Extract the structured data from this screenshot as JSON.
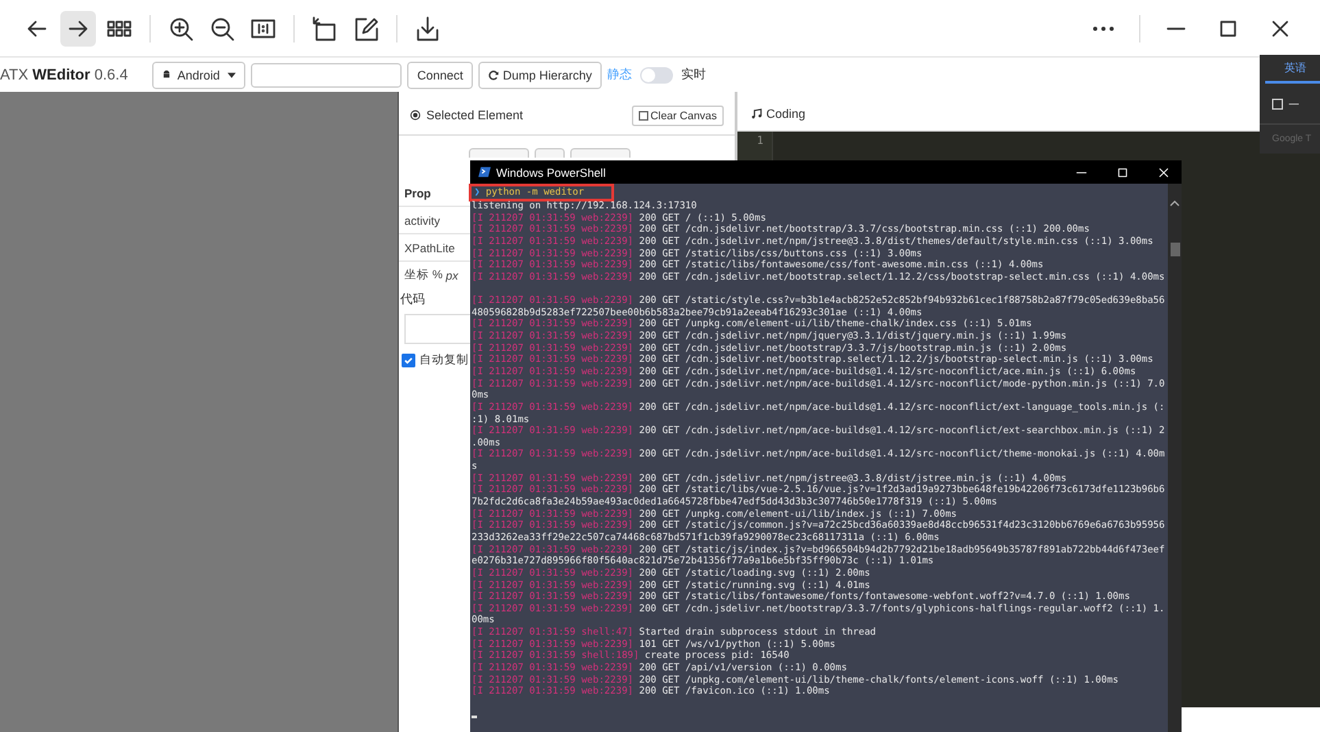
{
  "browser_toolbar": {
    "groups": [
      [
        {
          "kind": "back",
          "selected": false
        },
        {
          "kind": "forward",
          "selected": true
        },
        {
          "kind": "apps",
          "selected": false
        }
      ],
      [
        {
          "kind": "zoom-in",
          "selected": false
        },
        {
          "kind": "zoom-out",
          "selected": false
        },
        {
          "kind": "actual-size",
          "selected": false
        }
      ],
      [
        {
          "kind": "rotate",
          "selected": false
        },
        {
          "kind": "edit",
          "selected": false
        }
      ],
      [
        {
          "kind": "download",
          "selected": false
        }
      ]
    ],
    "window_buttons": [
      {
        "kind": "more"
      },
      {
        "kind": "minimize"
      },
      {
        "kind": "maximize"
      },
      {
        "kind": "close"
      }
    ]
  },
  "header": {
    "title": "ATX **WEditor** 0.6.4",
    "platform": "Android",
    "connect": "Connect",
    "dump": "Dump Hierarchy",
    "static_label": "静态",
    "live_label": "实时",
    "live": false
  },
  "inspector": {
    "title": "Selected Element",
    "clear": "Clear Canvas",
    "props": [
      "Prop",
      "activity",
      "XPathLite"
    ],
    "coord": "坐标 % *px*",
    "code": "代码",
    "auto_copy": {
      "label": "自动复制",
      "checked": true
    }
  },
  "coding": {
    "title": "Coding",
    "line_numbers": [
      "1"
    ]
  },
  "translate": {
    "tab": "英语",
    "option": {
      "label": "一",
      "checked": false
    },
    "footer": "Google T"
  },
  "powershell": {
    "title": "Windows PowerShell",
    "prompt": "❯",
    "command": "python -m weditor",
    "highlighted": true,
    "lines": [
      {
        "kind": "plain",
        "text": "listening on http://192.168.124.3:17310"
      },
      {
        "kind": "log",
        "prefix": "[I 211207 01:31:59 web:2239]",
        "text": "200 GET / (::1) 5.00ms"
      },
      {
        "kind": "log",
        "prefix": "[I 211207 01:31:59 web:2239]",
        "text": "200 GET /cdn.jsdelivr.net/bootstrap/3.3.7/css/bootstrap.min.css (::1) 200.00ms"
      },
      {
        "kind": "log",
        "prefix": "[I 211207 01:31:59 web:2239]",
        "text": "200 GET /cdn.jsdelivr.net/npm/jstree@3.3.8/dist/themes/default/style.min.css (::1) 3.00ms"
      },
      {
        "kind": "log",
        "prefix": "[I 211207 01:31:59 web:2239]",
        "text": "200 GET /static/libs/css/buttons.css (::1) 3.00ms"
      },
      {
        "kind": "log",
        "prefix": "[I 211207 01:31:59 web:2239]",
        "text": "200 GET /static/libs/fontawesome/css/font-awesome.min.css (::1) 4.00ms"
      },
      {
        "kind": "log",
        "prefix": "[I 211207 01:31:59 web:2239]",
        "text": "200 GET /cdn.jsdelivr.net/bootstrap.select/1.12.2/css/bootstrap-select.min.css (::1) 4.00ms"
      },
      {
        "kind": "blank"
      },
      {
        "kind": "log",
        "prefix": "[I 211207 01:31:59 web:2239]",
        "text": "200 GET /static/style.css?v=b3b1e4acb8252e52c852bf94b932b61cec1f88758b2a87f79c05ed639e8ba56"
      },
      {
        "kind": "plain",
        "text": "480596828b9d5283ef722507bee00b6b583a2bee79cb91a2eeab4f16293c301ae (::1) 4.00ms"
      },
      {
        "kind": "log",
        "prefix": "[I 211207 01:31:59 web:2239]",
        "text": "200 GET /unpkg.com/element-ui/lib/theme-chalk/index.css (::1) 5.01ms"
      },
      {
        "kind": "log",
        "prefix": "[I 211207 01:31:59 web:2239]",
        "text": "200 GET /cdn.jsdelivr.net/npm/jquery@3.3.1/dist/jquery.min.js (::1) 1.99ms"
      },
      {
        "kind": "log",
        "prefix": "[I 211207 01:31:59 web:2239]",
        "text": "200 GET /cdn.jsdelivr.net/bootstrap/3.3.7/js/bootstrap.min.js (::1) 2.00ms"
      },
      {
        "kind": "log",
        "prefix": "[I 211207 01:31:59 web:2239]",
        "text": "200 GET /cdn.jsdelivr.net/bootstrap.select/1.12.2/js/bootstrap-select.min.js (::1) 3.00ms"
      },
      {
        "kind": "log",
        "prefix": "[I 211207 01:31:59 web:2239]",
        "text": "200 GET /cdn.jsdelivr.net/npm/ace-builds@1.4.12/src-noconflict/ace.min.js (::1) 6.00ms"
      },
      {
        "kind": "log",
        "prefix": "[I 211207 01:31:59 web:2239]",
        "text": "200 GET /cdn.jsdelivr.net/npm/ace-builds@1.4.12/src-noconflict/mode-python.min.js (::1) 7.0"
      },
      {
        "kind": "plain",
        "text": "0ms"
      },
      {
        "kind": "log",
        "prefix": "[I 211207 01:31:59 web:2239]",
        "text": "200 GET /cdn.jsdelivr.net/npm/ace-builds@1.4.12/src-noconflict/ext-language_tools.min.js (:"
      },
      {
        "kind": "plain",
        "text": ":1) 8.01ms"
      },
      {
        "kind": "log",
        "prefix": "[I 211207 01:31:59 web:2239]",
        "text": "200 GET /cdn.jsdelivr.net/npm/ace-builds@1.4.12/src-noconflict/ext-searchbox.min.js (::1) 2"
      },
      {
        "kind": "plain",
        "text": ".00ms"
      },
      {
        "kind": "log",
        "prefix": "[I 211207 01:31:59 web:2239]",
        "text": "200 GET /cdn.jsdelivr.net/npm/ace-builds@1.4.12/src-noconflict/theme-monokai.js (::1) 4.00m"
      },
      {
        "kind": "plain",
        "text": "s"
      },
      {
        "kind": "log",
        "prefix": "[I 211207 01:31:59 web:2239]",
        "text": "200 GET /cdn.jsdelivr.net/npm/jstree@3.3.8/dist/jstree.min.js (::1) 4.00ms"
      },
      {
        "kind": "log",
        "prefix": "[I 211207 01:31:59 web:2239]",
        "text": "200 GET /static/libs/vue-2.5.16/vue.js?v=1f2d3ad19a9273bbe648fe19b42206f73c6173dfe1123b96b6"
      },
      {
        "kind": "plain",
        "text": "7b2fdc2d6ca8fa3e24b59ae493ac0ded1a6645728fbbe47edf5dd43d3b3c307746b50e1778f319 (::1) 5.00ms"
      },
      {
        "kind": "log",
        "prefix": "[I 211207 01:31:59 web:2239]",
        "text": "200 GET /unpkg.com/element-ui/lib/index.js (::1) 7.00ms"
      },
      {
        "kind": "log",
        "prefix": "[I 211207 01:31:59 web:2239]",
        "text": "200 GET /static/js/common.js?v=a72c25bcd36a60339ae8d48ccb96531f4d23c3120bb6769e6a6763b95956"
      },
      {
        "kind": "plain",
        "text": "233d3262ea33ff29e22c507ca74468c687bd571f1cb39fa9290078ec23c68117311a (::1) 6.00ms"
      },
      {
        "kind": "log",
        "prefix": "[I 211207 01:31:59 web:2239]",
        "text": "200 GET /static/js/index.js?v=bd966504b94d2b7792d21be18adb95649b35787f891ab722bb44d6f473eef"
      },
      {
        "kind": "plain",
        "text": "e0276b31e727d895966f80f5640ac821d75e72b41356f77a9a1b6e5bf35ff90b73c (::1) 1.01ms"
      },
      {
        "kind": "log",
        "prefix": "[I 211207 01:31:59 web:2239]",
        "text": "200 GET /static/loading.svg (::1) 2.00ms"
      },
      {
        "kind": "log",
        "prefix": "[I 211207 01:31:59 web:2239]",
        "text": "200 GET /static/running.svg (::1) 4.01ms"
      },
      {
        "kind": "log",
        "prefix": "[I 211207 01:31:59 web:2239]",
        "text": "200 GET /static/libs/fontawesome/fonts/fontawesome-webfont.woff2?v=4.7.0 (::1) 1.00ms"
      },
      {
        "kind": "log",
        "prefix": "[I 211207 01:31:59 web:2239]",
        "text": "200 GET /cdn.jsdelivr.net/bootstrap/3.3.7/fonts/glyphicons-halflings-regular.woff2 (::1) 1."
      },
      {
        "kind": "plain",
        "text": "00ms"
      },
      {
        "kind": "log",
        "prefix": "[I 211207 01:31:59 shell:47]",
        "text": "Started drain subprocess stdout in thread"
      },
      {
        "kind": "log",
        "prefix": "[I 211207 01:31:59 web:2239]",
        "text": "101 GET /ws/v1/python (::1) 5.00ms"
      },
      {
        "kind": "log",
        "prefix": "[I 211207 01:31:59 shell:189]",
        "text": "create process pid: 16540"
      },
      {
        "kind": "log",
        "prefix": "[I 211207 01:31:59 web:2239]",
        "text": "200 GET /api/v1/version (::1) 0.00ms"
      },
      {
        "kind": "log",
        "prefix": "[I 211207 01:31:59 web:2239]",
        "text": "200 GET /unpkg.com/element-ui/lib/theme-chalk/fonts/element-icons.woff (::1) 1.00ms"
      },
      {
        "kind": "log",
        "prefix": "[I 211207 01:31:59 web:2239]",
        "text": "200 GET /favicon.ico (::1) 1.00ms"
      },
      {
        "kind": "blank"
      },
      {
        "kind": "cursor"
      }
    ]
  }
}
